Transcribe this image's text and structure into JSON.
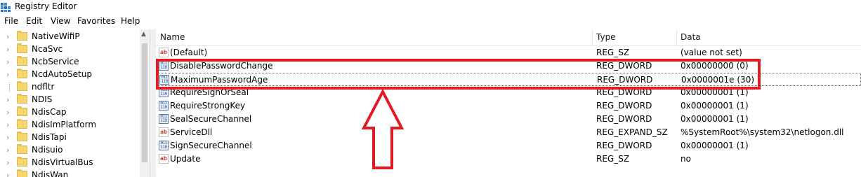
{
  "window": {
    "title": "Registry Editor"
  },
  "menu": [
    "File",
    "Edit",
    "View",
    "Favorites",
    "Help"
  ],
  "tree": {
    "items": [
      {
        "label": "NativeWifiP",
        "expandable": true
      },
      {
        "label": "NcaSvc",
        "expandable": true
      },
      {
        "label": "NcbService",
        "expandable": true
      },
      {
        "label": "NcdAutoSetup",
        "expandable": true
      },
      {
        "label": "ndfltr",
        "expandable": false
      },
      {
        "label": "NDIS",
        "expandable": true
      },
      {
        "label": "NdisCap",
        "expandable": true
      },
      {
        "label": "NdisImPlatform",
        "expandable": true
      },
      {
        "label": "NdisTapi",
        "expandable": true
      },
      {
        "label": "Ndisuio",
        "expandable": true
      },
      {
        "label": "NdisVirtualBus",
        "expandable": true
      },
      {
        "label": "NdisWan",
        "expandable": true
      }
    ]
  },
  "list": {
    "columns": {
      "name": "Name",
      "type": "Type",
      "data": "Data"
    },
    "rows": [
      {
        "name": "(Default)",
        "type": "REG_SZ",
        "data": "(value not set)",
        "icon": "string-value-icon"
      },
      {
        "name": "DisablePasswordChange",
        "type": "REG_DWORD",
        "data": "0x00000000 (0)",
        "icon": "binary-value-icon"
      },
      {
        "name": "MaximumPasswordAge",
        "type": "REG_DWORD",
        "data": "0x0000001e (30)",
        "icon": "binary-value-icon"
      },
      {
        "name": "RequireSignOrSeal",
        "type": "REG_DWORD",
        "data": "0x00000001 (1)",
        "icon": "binary-value-icon"
      },
      {
        "name": "RequireStrongKey",
        "type": "REG_DWORD",
        "data": "0x00000001 (1)",
        "icon": "binary-value-icon"
      },
      {
        "name": "SealSecureChannel",
        "type": "REG_DWORD",
        "data": "0x00000001 (1)",
        "icon": "binary-value-icon"
      },
      {
        "name": "ServiceDll",
        "type": "REG_EXPAND_SZ",
        "data": "%SystemRoot%\\system32\\netlogon.dll",
        "icon": "string-value-icon"
      },
      {
        "name": "SignSecureChannel",
        "type": "REG_DWORD",
        "data": "0x00000001 (1)",
        "icon": "binary-value-icon"
      },
      {
        "name": "Update",
        "type": "REG_SZ",
        "data": "no",
        "icon": "string-value-icon"
      }
    ]
  },
  "colors": {
    "highlight": "#e21b23",
    "folder": "#f5d76e"
  }
}
